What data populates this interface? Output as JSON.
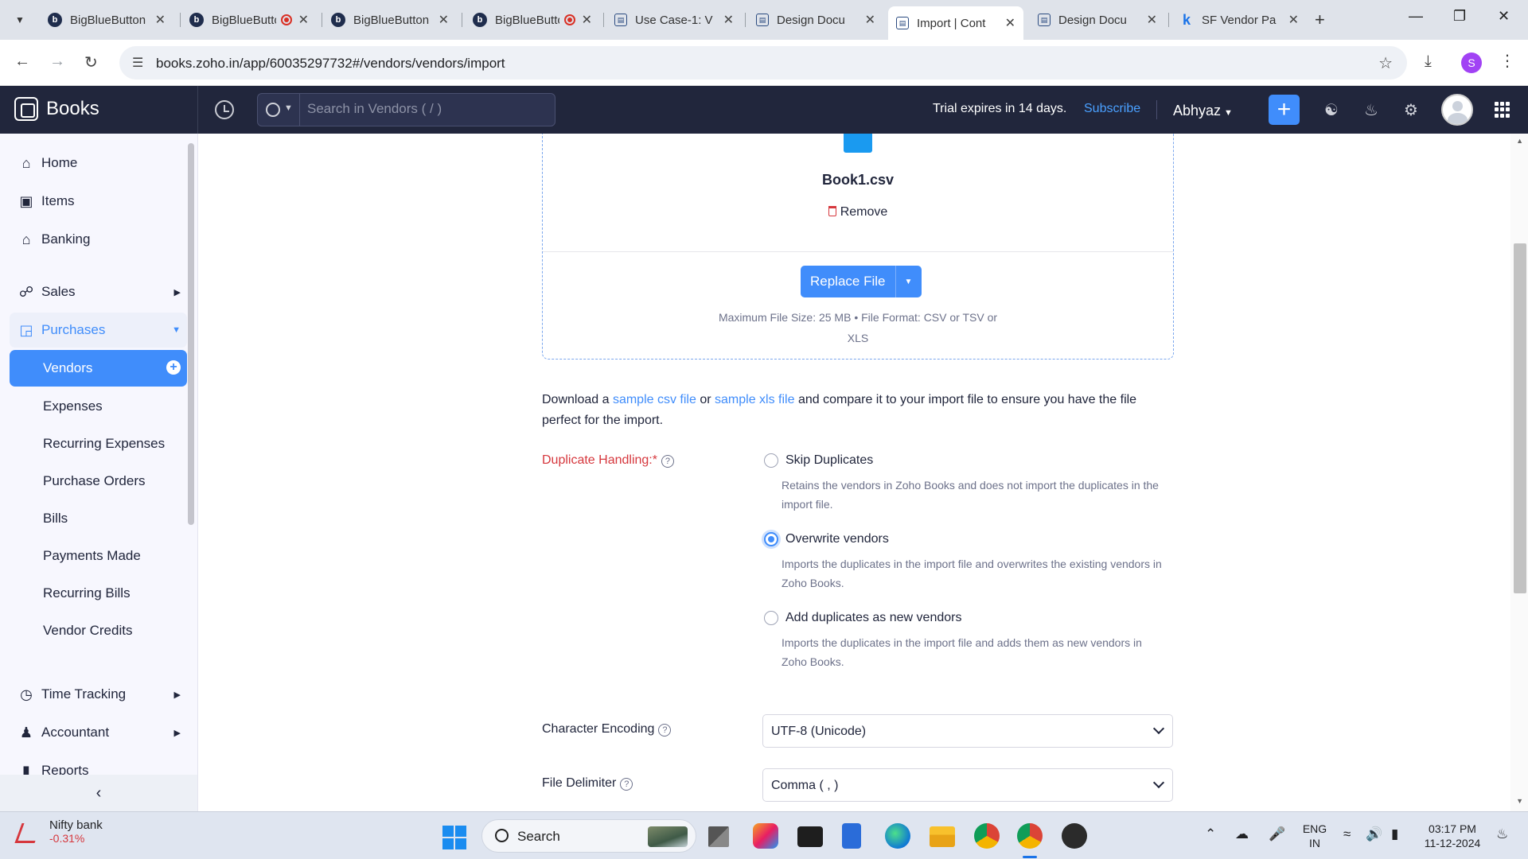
{
  "browser": {
    "tabs": [
      {
        "label": "BigBlueButton",
        "favicon": "b",
        "recording": false
      },
      {
        "label": "BigBlueButton",
        "favicon": "b",
        "recording": true
      },
      {
        "label": "BigBlueButton",
        "favicon": "b",
        "recording": false
      },
      {
        "label": "BigBlueButton",
        "favicon": "b",
        "recording": true
      },
      {
        "label": "Use Case-1: V",
        "favicon": "doc",
        "recording": false
      },
      {
        "label": "Design Docu",
        "favicon": "doc",
        "recording": false
      },
      {
        "label": "Import | Cont",
        "favicon": "books",
        "recording": false,
        "active": true
      },
      {
        "label": "Design Docu",
        "favicon": "doc",
        "recording": false
      },
      {
        "label": "SF Vendor Pa",
        "favicon": "k",
        "recording": false
      }
    ],
    "url": "books.zoho.in/app/60035297732#/vendors/vendors/import",
    "profile_initial": "S"
  },
  "app_header": {
    "brand": "Books",
    "search_placeholder": "Search in Vendors ( / )",
    "trial_text": "Trial expires in 14 days.",
    "subscribe_label": "Subscribe",
    "org_name": "Abhyaz",
    "plus_label": "+"
  },
  "sidebar": {
    "items": [
      {
        "label": "Home",
        "icon": "home-icon"
      },
      {
        "label": "Items",
        "icon": "items-icon"
      },
      {
        "label": "Banking",
        "icon": "bank-icon"
      },
      {
        "label": "Sales",
        "icon": "cart-icon"
      },
      {
        "label": "Purchases",
        "icon": "bag-icon"
      },
      {
        "label": "Time Tracking",
        "icon": "clock-icon"
      },
      {
        "label": "Accountant",
        "icon": "accountant-icon"
      },
      {
        "label": "Reports",
        "icon": "reports-icon"
      }
    ],
    "purchases_sub": [
      "Vendors",
      "Expenses",
      "Recurring Expenses",
      "Purchase Orders",
      "Bills",
      "Payments Made",
      "Recurring Bills",
      "Vendor Credits"
    ]
  },
  "upload": {
    "file_name": "Book1.csv",
    "remove_label": "Remove",
    "replace_label": "Replace File",
    "max_size": "Maximum File Size: 25 MB",
    "file_format_line1": "File Format: CSV or TSV or",
    "file_format_line2": "XLS"
  },
  "download_note": {
    "prefix": "Download a",
    "csv_link": "sample csv file",
    "or": "or",
    "xls_link": "sample xls file",
    "suffix": "and compare it to your import file to ensure you have the file perfect for the import."
  },
  "duplicate_handling": {
    "label": "Duplicate Handling:*",
    "options": [
      {
        "label": "Skip Duplicates",
        "desc": "Retains the vendors in Zoho Books and does not import the duplicates in the import file.",
        "checked": false
      },
      {
        "label": "Overwrite vendors",
        "desc": "Imports the duplicates in the import file and overwrites the existing vendors in Zoho Books.",
        "checked": true
      },
      {
        "label": "Add duplicates as new vendors",
        "desc": "Imports the duplicates in the import file and adds them as new vendors in Zoho Books.",
        "checked": false
      }
    ]
  },
  "character_encoding": {
    "label": "Character Encoding",
    "value": "UTF-8 (Unicode)"
  },
  "file_delimiter": {
    "label": "File Delimiter",
    "value": "Comma ( , )"
  },
  "taskbar": {
    "ticker_name": "Nifty bank",
    "ticker_change": "-0.31%",
    "search_label": "Search",
    "lang_line1": "ENG",
    "lang_line2": "IN",
    "time": "03:17 PM",
    "date": "11-12-2024"
  },
  "colors": {
    "accent": "#408dfb",
    "header_bg": "#21263c",
    "danger": "#d6373d"
  }
}
